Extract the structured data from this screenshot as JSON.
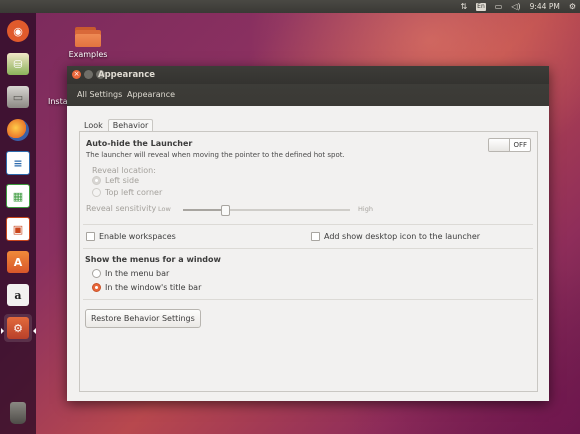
{
  "topbar": {
    "lang": "En",
    "clock": "9:44 PM",
    "icons": [
      "sort-arrows-icon",
      "keyboard-lang-icon",
      "battery-icon",
      "volume-icon",
      "settings-gear-icon"
    ]
  },
  "launcher": {
    "items": [
      {
        "name": "ubuntu-dash-icon",
        "color": "#e05a2c",
        "glyph": "◉"
      },
      {
        "name": "backup-app-icon",
        "color": "#5c8a3a",
        "glyph": "⛁"
      },
      {
        "name": "files-app-icon",
        "color": "#8c8984",
        "glyph": "▭"
      },
      {
        "name": "firefox-icon",
        "color": "#e8762a",
        "glyph": "◐"
      },
      {
        "name": "writer-icon",
        "color": "#2e6cae",
        "glyph": "≡"
      },
      {
        "name": "calc-icon",
        "color": "#3e9c40",
        "glyph": "▦"
      },
      {
        "name": "impress-icon",
        "color": "#c9461c",
        "glyph": "▣"
      },
      {
        "name": "software-center-icon",
        "color": "#e06a2a",
        "glyph": "A"
      },
      {
        "name": "amazon-icon",
        "color": "#e8e6e3",
        "glyph": "a"
      },
      {
        "name": "system-settings-icon",
        "color": "#d14f2a",
        "glyph": "⚙"
      },
      {
        "name": "trash-icon",
        "color": "#6a6863",
        "glyph": "🗑"
      }
    ]
  },
  "desktop": {
    "icon_label": "Examples",
    "partial_label": "Insta"
  },
  "window": {
    "title": "Appearance",
    "breadcrumb": [
      "All Settings",
      "Appearance"
    ],
    "tabs": [
      "Look",
      "Behavior"
    ],
    "active_tab": "Behavior",
    "autohide": {
      "title": "Auto-hide the Launcher",
      "desc": "The launcher will reveal when moving the pointer to the defined hot spot.",
      "toggle_state": "OFF",
      "reveal_location_label": "Reveal location:",
      "reveal_options": [
        "Left side",
        "Top left corner"
      ],
      "sensitivity_label": "Reveal sensitivity",
      "sensitivity_low": "Low",
      "sensitivity_high": "High",
      "sensitivity_level": 0.25
    },
    "enable_workspaces": "Enable workspaces",
    "show_desktop_icon": "Add show desktop icon to the launcher",
    "menus": {
      "title": "Show the menus for a window",
      "options": [
        "In the menu bar",
        "In the window's title bar"
      ],
      "selected": 1
    },
    "restore_button": "Restore Behavior Settings"
  },
  "colors": {
    "accent": "#e9673a",
    "titlebar": "#3c3b37"
  }
}
